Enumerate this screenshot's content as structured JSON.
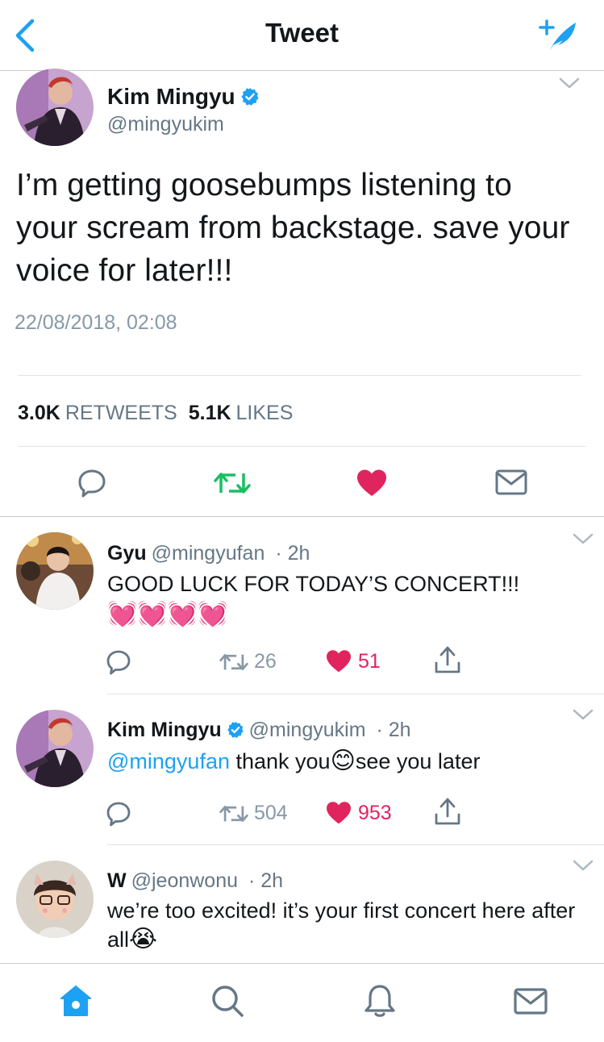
{
  "header": {
    "title": "Tweet"
  },
  "main_tweet": {
    "name": "Kim Mingyu",
    "handle": "@mingyukim",
    "text": "I’m getting goosebumps listening to your scream from backstage. save your voice for later!!!",
    "timestamp": "22/08/2018, 02:08",
    "retweets": "3.0K",
    "retweets_label": "RETWEETS",
    "likes": "5.1K",
    "likes_label": "LIKES"
  },
  "replies": [
    {
      "name": "Gyu",
      "handle": "@mingyufan",
      "time": "· 2h",
      "text": "GOOD LUCK FOR TODAY’S CONCERT!!!",
      "emoji": "💓💓💓💓",
      "retweets": "26",
      "likes": "51"
    },
    {
      "name": "Kim Mingyu",
      "handle": "@mingyukim",
      "time": "· 2h",
      "mention": "@mingyufan",
      "text_a": " thank you",
      "emoji": "😊",
      "text_b": "see you later",
      "retweets": "504",
      "likes": "953"
    },
    {
      "name": "W",
      "handle": "@jeonwonu",
      "time": "· 2h",
      "text": "we’re too excited! it’s your first concert here after all",
      "emoji": "😭"
    }
  ],
  "icons": {
    "back": "chevron-left-icon",
    "compose": "compose-tweet-icon",
    "reply": "reply-icon",
    "retweet": "retweet-icon",
    "like": "heart-icon",
    "dm": "envelope-icon",
    "share": "share-icon",
    "home": "home-icon",
    "search": "search-icon",
    "notifications": "bell-icon",
    "messages": "envelope-icon"
  },
  "colors": {
    "accent": "#1da1f2",
    "retweet_green": "#17bf63",
    "like_red": "#e0245e",
    "text": "#14171a",
    "secondary": "#657786"
  }
}
